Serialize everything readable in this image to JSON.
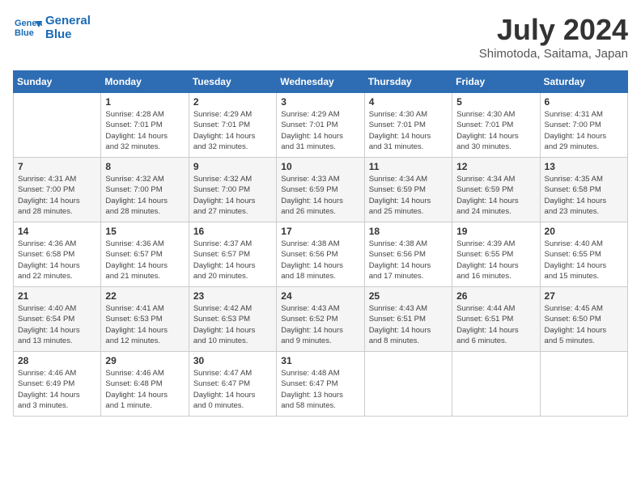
{
  "header": {
    "logo_line1": "General",
    "logo_line2": "Blue",
    "month": "July 2024",
    "location": "Shimotoda, Saitama, Japan"
  },
  "weekdays": [
    "Sunday",
    "Monday",
    "Tuesday",
    "Wednesday",
    "Thursday",
    "Friday",
    "Saturday"
  ],
  "weeks": [
    [
      {
        "day": "",
        "info": ""
      },
      {
        "day": "1",
        "info": "Sunrise: 4:28 AM\nSunset: 7:01 PM\nDaylight: 14 hours\nand 32 minutes."
      },
      {
        "day": "2",
        "info": "Sunrise: 4:29 AM\nSunset: 7:01 PM\nDaylight: 14 hours\nand 32 minutes."
      },
      {
        "day": "3",
        "info": "Sunrise: 4:29 AM\nSunset: 7:01 PM\nDaylight: 14 hours\nand 31 minutes."
      },
      {
        "day": "4",
        "info": "Sunrise: 4:30 AM\nSunset: 7:01 PM\nDaylight: 14 hours\nand 31 minutes."
      },
      {
        "day": "5",
        "info": "Sunrise: 4:30 AM\nSunset: 7:01 PM\nDaylight: 14 hours\nand 30 minutes."
      },
      {
        "day": "6",
        "info": "Sunrise: 4:31 AM\nSunset: 7:00 PM\nDaylight: 14 hours\nand 29 minutes."
      }
    ],
    [
      {
        "day": "7",
        "info": "Sunrise: 4:31 AM\nSunset: 7:00 PM\nDaylight: 14 hours\nand 28 minutes."
      },
      {
        "day": "8",
        "info": "Sunrise: 4:32 AM\nSunset: 7:00 PM\nDaylight: 14 hours\nand 28 minutes."
      },
      {
        "day": "9",
        "info": "Sunrise: 4:32 AM\nSunset: 7:00 PM\nDaylight: 14 hours\nand 27 minutes."
      },
      {
        "day": "10",
        "info": "Sunrise: 4:33 AM\nSunset: 6:59 PM\nDaylight: 14 hours\nand 26 minutes."
      },
      {
        "day": "11",
        "info": "Sunrise: 4:34 AM\nSunset: 6:59 PM\nDaylight: 14 hours\nand 25 minutes."
      },
      {
        "day": "12",
        "info": "Sunrise: 4:34 AM\nSunset: 6:59 PM\nDaylight: 14 hours\nand 24 minutes."
      },
      {
        "day": "13",
        "info": "Sunrise: 4:35 AM\nSunset: 6:58 PM\nDaylight: 14 hours\nand 23 minutes."
      }
    ],
    [
      {
        "day": "14",
        "info": "Sunrise: 4:36 AM\nSunset: 6:58 PM\nDaylight: 14 hours\nand 22 minutes."
      },
      {
        "day": "15",
        "info": "Sunrise: 4:36 AM\nSunset: 6:57 PM\nDaylight: 14 hours\nand 21 minutes."
      },
      {
        "day": "16",
        "info": "Sunrise: 4:37 AM\nSunset: 6:57 PM\nDaylight: 14 hours\nand 20 minutes."
      },
      {
        "day": "17",
        "info": "Sunrise: 4:38 AM\nSunset: 6:56 PM\nDaylight: 14 hours\nand 18 minutes."
      },
      {
        "day": "18",
        "info": "Sunrise: 4:38 AM\nSunset: 6:56 PM\nDaylight: 14 hours\nand 17 minutes."
      },
      {
        "day": "19",
        "info": "Sunrise: 4:39 AM\nSunset: 6:55 PM\nDaylight: 14 hours\nand 16 minutes."
      },
      {
        "day": "20",
        "info": "Sunrise: 4:40 AM\nSunset: 6:55 PM\nDaylight: 14 hours\nand 15 minutes."
      }
    ],
    [
      {
        "day": "21",
        "info": "Sunrise: 4:40 AM\nSunset: 6:54 PM\nDaylight: 14 hours\nand 13 minutes."
      },
      {
        "day": "22",
        "info": "Sunrise: 4:41 AM\nSunset: 6:53 PM\nDaylight: 14 hours\nand 12 minutes."
      },
      {
        "day": "23",
        "info": "Sunrise: 4:42 AM\nSunset: 6:53 PM\nDaylight: 14 hours\nand 10 minutes."
      },
      {
        "day": "24",
        "info": "Sunrise: 4:43 AM\nSunset: 6:52 PM\nDaylight: 14 hours\nand 9 minutes."
      },
      {
        "day": "25",
        "info": "Sunrise: 4:43 AM\nSunset: 6:51 PM\nDaylight: 14 hours\nand 8 minutes."
      },
      {
        "day": "26",
        "info": "Sunrise: 4:44 AM\nSunset: 6:51 PM\nDaylight: 14 hours\nand 6 minutes."
      },
      {
        "day": "27",
        "info": "Sunrise: 4:45 AM\nSunset: 6:50 PM\nDaylight: 14 hours\nand 5 minutes."
      }
    ],
    [
      {
        "day": "28",
        "info": "Sunrise: 4:46 AM\nSunset: 6:49 PM\nDaylight: 14 hours\nand 3 minutes."
      },
      {
        "day": "29",
        "info": "Sunrise: 4:46 AM\nSunset: 6:48 PM\nDaylight: 14 hours\nand 1 minute."
      },
      {
        "day": "30",
        "info": "Sunrise: 4:47 AM\nSunset: 6:47 PM\nDaylight: 14 hours\nand 0 minutes."
      },
      {
        "day": "31",
        "info": "Sunrise: 4:48 AM\nSunset: 6:47 PM\nDaylight: 13 hours\nand 58 minutes."
      },
      {
        "day": "",
        "info": ""
      },
      {
        "day": "",
        "info": ""
      },
      {
        "day": "",
        "info": ""
      }
    ]
  ]
}
